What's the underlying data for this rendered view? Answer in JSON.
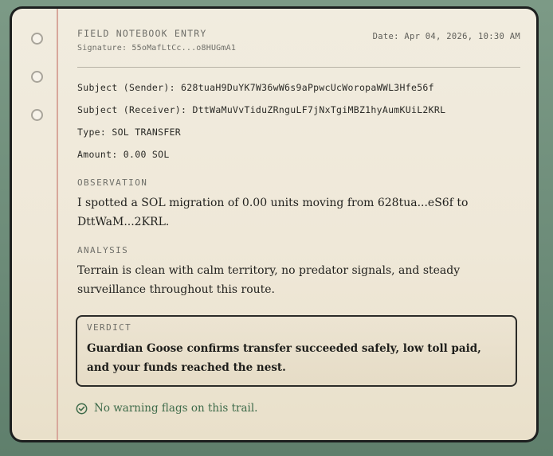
{
  "entry": {
    "title": "FIELD NOTEBOOK ENTRY",
    "signature": "Signature: 55oMafLtCc...o8HUGmA1",
    "date": "Date: Apr 04, 2026, 10:30 AM"
  },
  "fields": {
    "sender": "Subject (Sender): 628tuaH9DuYK7W36wW6s9aPpwcUcWoropaWWL3Hfe56f",
    "receiver": "Subject (Receiver): DttWaMuVvTiduZRnguLF7jNxTgiMBZ1hyAumKUiL2KRL",
    "type": "Type: SOL TRANSFER",
    "amount": "Amount: 0.00 SOL"
  },
  "observation": {
    "label": "OBSERVATION",
    "text": "I spotted a SOL migration of 0.00 units moving from 628tua...eS6f to DttWaM...2KRL."
  },
  "analysis": {
    "label": "ANALYSIS",
    "text": "Terrain is clean with calm territory, no predator signals, and steady surveillance throughout this route."
  },
  "verdict": {
    "label": "VERDICT",
    "text": "Guardian Goose confirms transfer succeeded safely, low toll paid, and your funds reached the nest."
  },
  "footer": {
    "icon": "check-circle-icon",
    "text": "No warning flags on this trail."
  },
  "colors": {
    "background": "#6f8f7c",
    "paper": "#efe8d8",
    "margin_line": "#d8a79b",
    "success": "#3e6b4a",
    "ink": "#22221f"
  }
}
